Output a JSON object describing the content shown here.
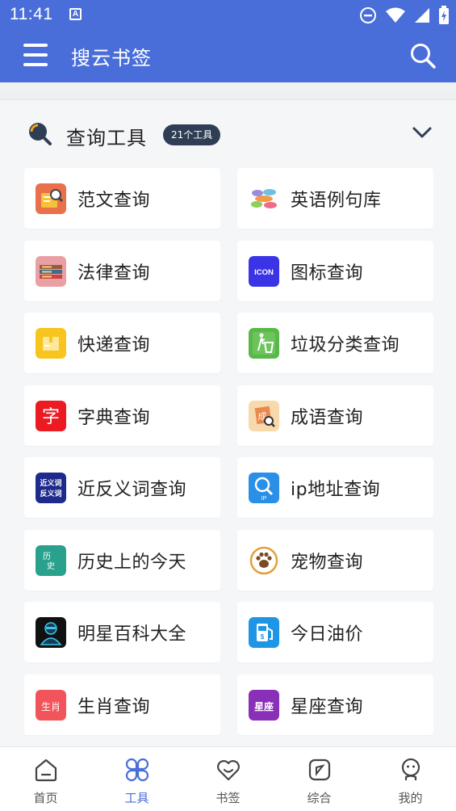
{
  "status_bar": {
    "time": "11:41",
    "app_indicator": "A"
  },
  "app_bar": {
    "title": "搜云书签",
    "menu_icon": "menu-icon",
    "search_icon": "search-icon"
  },
  "section": {
    "title": "查询工具",
    "badge": "21个工具",
    "expanded_icon": "chevron-down-icon"
  },
  "tools": [
    {
      "label": "范文查询",
      "icon": "essay-icon",
      "color": "#e8704a"
    },
    {
      "label": "英语例句库",
      "icon": "english-bubbles-icon",
      "color": "#f2f2f2"
    },
    {
      "label": "法律查询",
      "icon": "law-books-icon",
      "color": "#e9a0a4"
    },
    {
      "label": "图标查询",
      "icon": "icon-search-icon",
      "color": "#3b33e6"
    },
    {
      "label": "快递查询",
      "icon": "express-box-icon",
      "color": "#f7c51e"
    },
    {
      "label": "垃圾分类查询",
      "icon": "trash-sort-icon",
      "color": "#58b948"
    },
    {
      "label": "字典查询",
      "icon": "dictionary-icon",
      "color": "#ec1b22"
    },
    {
      "label": "成语查询",
      "icon": "idiom-icon",
      "color": "#f8d9ac"
    },
    {
      "label": "近反义词查询",
      "icon": "synonym-icon",
      "color": "#1e2a8c"
    },
    {
      "label": "ip地址查询",
      "icon": "ip-lookup-icon",
      "color": "#2a8fe6"
    },
    {
      "label": "历史上的今天",
      "icon": "history-icon",
      "color": "#29a18c"
    },
    {
      "label": "宠物查询",
      "icon": "pet-paw-icon",
      "color": "#ffffff"
    },
    {
      "label": "明星百科大全",
      "icon": "celebrity-icon",
      "color": "#111111"
    },
    {
      "label": "今日油价",
      "icon": "fuel-price-icon",
      "color": "#1f95e6"
    },
    {
      "label": "生肖查询",
      "icon": "zodiac-animal-icon",
      "color": "#f2545b"
    },
    {
      "label": "星座查询",
      "icon": "constellation-icon",
      "color": "#8a2fb8"
    }
  ],
  "tool_icon_text": {
    "dictionary": "字",
    "icon_search": "ICON",
    "synonym_line1": "近义词",
    "synonym_line2": "反义词",
    "history_line1": "历",
    "history_line2": "史",
    "ip": "IP",
    "zodiac": "生肖",
    "constellation": "星座",
    "idiom": "成"
  },
  "tab_bar": [
    {
      "label": "首页",
      "icon": "home-icon",
      "active": false
    },
    {
      "label": "工具",
      "icon": "tools-clover-icon",
      "active": true
    },
    {
      "label": "书签",
      "icon": "bookmark-heart-icon",
      "active": false
    },
    {
      "label": "综合",
      "icon": "compass-icon",
      "active": false
    },
    {
      "label": "我的",
      "icon": "profile-icon",
      "active": false
    }
  ],
  "colors": {
    "primary": "#4a6ed9",
    "badge_bg": "#2f3e54",
    "background": "#f5f6f8"
  }
}
